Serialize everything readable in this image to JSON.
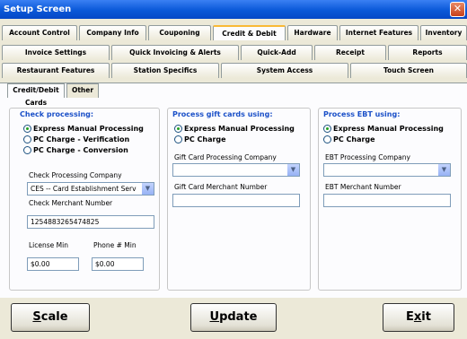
{
  "window": {
    "title": "Setup Screen",
    "close_glyph": "✕"
  },
  "tabs": {
    "row1": [
      "Account Control",
      "Company Info",
      "Couponing",
      "Credit & Debit",
      "Hardware",
      "Internet Features",
      "Inventory"
    ],
    "row2": [
      "Invoice Settings",
      "Quick Invoicing & Alerts",
      "Quick-Add",
      "Receipt",
      "Reports"
    ],
    "row3": [
      "Restaurant Features",
      "Station Specifics",
      "System Access",
      "Touch Screen"
    ],
    "active": "Credit & Debit"
  },
  "subtabs": [
    "Credit/Debit Cards",
    "Other"
  ],
  "check": {
    "title": "Check processing:",
    "options": [
      "Express Manual Processing",
      "PC Charge - Verification",
      "PC Charge - Conversion"
    ],
    "selected": "Express Manual Processing",
    "company_label": "Check Processing Company",
    "company_value": "CES -- Card Establishment Serv",
    "merchant_label": "Check Merchant Number",
    "merchant_value": "1254883265474825",
    "license_label": "License Min",
    "license_value": "$0.00",
    "phone_label": "Phone # Min",
    "phone_value": "$0.00"
  },
  "gift": {
    "title": "Process gift cards using:",
    "options": [
      "Express Manual Processing",
      "PC Charge"
    ],
    "selected": "Express Manual Processing",
    "company_label": "Gift Card Processing Company",
    "company_value": "",
    "merchant_label": "Gift Card Merchant Number",
    "merchant_value": ""
  },
  "ebt": {
    "title": "Process EBT using:",
    "options": [
      "Express Manual Processing",
      "PC Charge"
    ],
    "selected": "Express Manual Processing",
    "company_label": "EBT Processing Company",
    "company_value": "",
    "merchant_label": "EBT Merchant Number",
    "merchant_value": ""
  },
  "buttons": {
    "scale": {
      "first": "S",
      "rest": "cale"
    },
    "update": {
      "first": "U",
      "rest": "pdate"
    },
    "exit": {
      "pre": "E",
      "under": "x",
      "post": "it"
    }
  },
  "icons": {
    "dropdown": "chevron-down-icon",
    "close": "close-icon"
  },
  "colors": {
    "titlebar": "#0a58d8",
    "group_title": "#1b50c8",
    "radio_selected": "#21a121",
    "active_tab_accent": "#f9b936"
  }
}
